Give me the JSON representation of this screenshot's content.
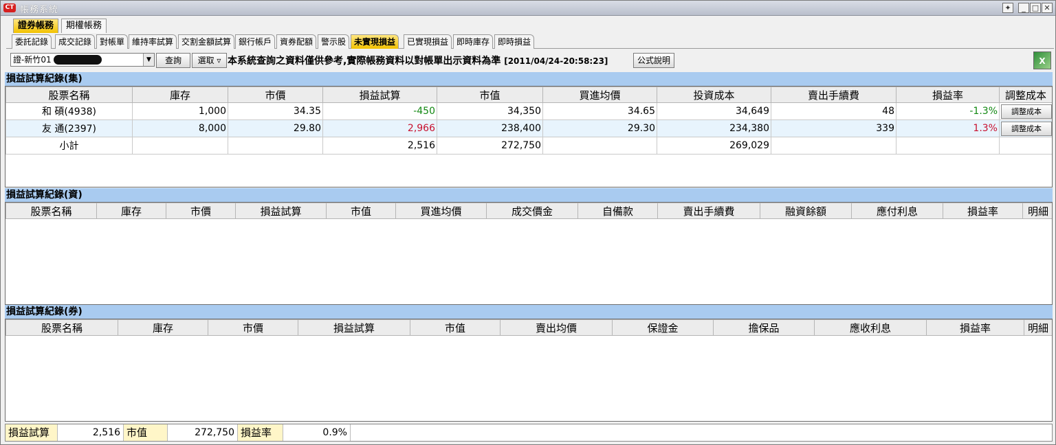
{
  "window": {
    "title": "帳務系統",
    "logo": "CT"
  },
  "top_tabs": [
    "證券帳務",
    "期權帳務"
  ],
  "sub_tabs": [
    "委託記錄",
    "成交記錄",
    "對帳單",
    "維持率試算",
    "交割金額試算",
    "銀行帳戶",
    "資券配額",
    "警示股",
    "未實現損益",
    "已實現損益",
    "即時庫存",
    "即時損益"
  ],
  "toolbar": {
    "account": "證-新竹01",
    "query_label": "查詢",
    "select_label": "選取",
    "select_arrow": "▿",
    "notice": "本系統查詢之資料僅供參考,實際帳務資料以對帳單出示資料為準",
    "timestamp": "[2011/04/24-20:58:23]",
    "formula_label": "公式說明",
    "excel_icon": "excel-export-icon"
  },
  "section1": {
    "title": "損益試算紀錄(集)",
    "headers": [
      "股票名稱",
      "庫存",
      "市價",
      "損益試算",
      "市值",
      "買進均價",
      "投資成本",
      "賣出手續費",
      "損益率",
      "調整成本"
    ],
    "rows": [
      [
        "和 碩(4938)",
        "1,000",
        "34.35",
        "-450",
        "34,350",
        "34.65",
        "34,649",
        "48",
        "-1.3%",
        "調整成本"
      ],
      [
        "友 通(2397)",
        "8,000",
        "29.80",
        "2,966",
        "238,400",
        "29.30",
        "234,380",
        "339",
        "1.3%",
        "調整成本"
      ],
      [
        "小計",
        "",
        "",
        "2,516",
        "272,750",
        "",
        "269,029",
        "",
        "",
        ""
      ]
    ]
  },
  "section2": {
    "title": "損益試算紀錄(資)",
    "headers": [
      "股票名稱",
      "庫存",
      "市價",
      "損益試算",
      "市值",
      "買進均價",
      "成交價金",
      "自備款",
      "賣出手續費",
      "融資餘額",
      "應付利息",
      "損益率",
      "明細"
    ]
  },
  "section3": {
    "title": "損益試算紀錄(券)",
    "headers": [
      "股票名稱",
      "庫存",
      "市價",
      "損益試算",
      "市值",
      "賣出均價",
      "保證金",
      "擔保品",
      "應收利息",
      "損益率",
      "明細"
    ]
  },
  "footer": {
    "pl_label": "損益試算",
    "pl_value": "2,516",
    "mv_label": "市值",
    "mv_value": "272,750",
    "rate_label": "損益率",
    "rate_value": "0.9%"
  },
  "colors": {
    "gain": "#c8102e",
    "loss": "#118811",
    "section_bg": "#a9cbf0",
    "active_tab": "#f2c200"
  }
}
